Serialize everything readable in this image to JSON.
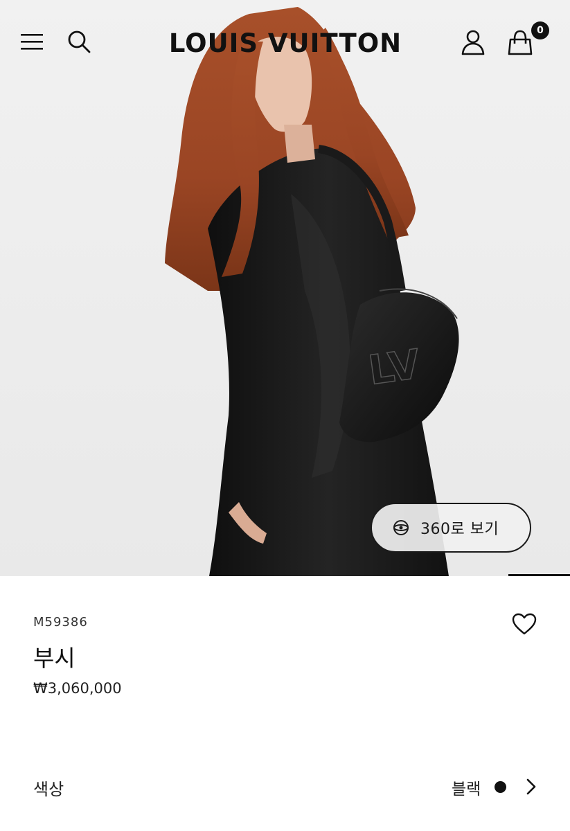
{
  "header": {
    "logo_text": "LOUIS VUITTON",
    "bag_count": "0",
    "icons": [
      "menu-icon",
      "search-icon",
      "account-icon",
      "shopping-bag-icon"
    ]
  },
  "hero": {
    "view360_label": "360로 보기",
    "view360_icon": "rotate-360-icon"
  },
  "product": {
    "sku": "M59386",
    "name": "부시",
    "price": "₩3,060,000",
    "wishlist_icon": "heart-icon"
  },
  "color": {
    "label": "색상",
    "value": "블랙",
    "swatch_color": "#111111"
  }
}
